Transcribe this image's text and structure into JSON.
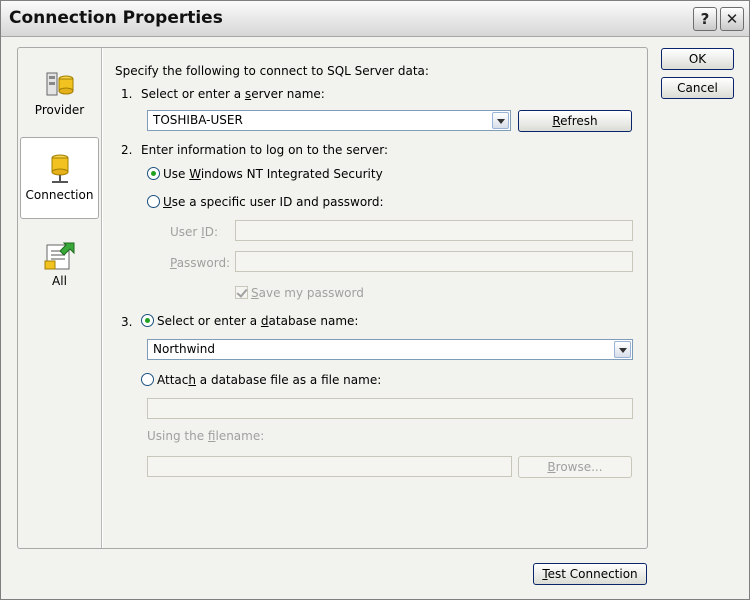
{
  "window": {
    "title": "Connection Properties",
    "help_label": "?",
    "close_label": "✕"
  },
  "nav": [
    {
      "label": "Provider",
      "icon": "provider-icon"
    },
    {
      "label": "Connection",
      "icon": "connection-icon",
      "selected": true
    },
    {
      "label": "All",
      "icon": "all-icon"
    }
  ],
  "intro": "Specify the following to connect to SQL Server data:",
  "step1": {
    "number": "1.",
    "label_pre": "Select or enter a ",
    "label_accel": "s",
    "label_post": "erver name:",
    "server_value": "TOSHIBA-USER",
    "refresh_accel": "R",
    "refresh_rest": "efresh"
  },
  "step2": {
    "number": "2.",
    "label": "Enter information to log on to the server:",
    "option_windows_pre": "Use ",
    "option_windows_accel": "W",
    "option_windows_post": "indows NT Integrated Security",
    "option_windows_checked": true,
    "option_sql_accel": "U",
    "option_sql_post": "se a specific user ID and password:",
    "user_id_pre": "User ",
    "user_id_accel": "I",
    "user_id_post": "D:",
    "password_accel": "P",
    "password_post": "assword:",
    "save_password_accel": "S",
    "save_password_post": "ave my password",
    "save_password_checked": true
  },
  "step3": {
    "number": "3.",
    "option_select_pre": "Select or enter a ",
    "option_select_accel": "d",
    "option_select_post": "atabase name:",
    "option_select_checked": true,
    "database_value": "Northwind",
    "option_attach_pre": "Attac",
    "option_attach_accel": "h",
    "option_attach_post": " a database file as a file name:",
    "logical_name_pre": "Using the ",
    "logical_name_accel": "f",
    "logical_name_post": "ilename:",
    "browse_accel": "B",
    "browse_rest": "rowse..."
  },
  "buttons": {
    "ok": "OK",
    "cancel": "Cancel",
    "test_accel": "T",
    "test_rest": "est Connection"
  },
  "colors": {
    "window_bg": "#f2f2ee",
    "field_border": "#7f9db9",
    "radio_dot": "#21a121",
    "disabled_text": "#a0a0a0"
  }
}
